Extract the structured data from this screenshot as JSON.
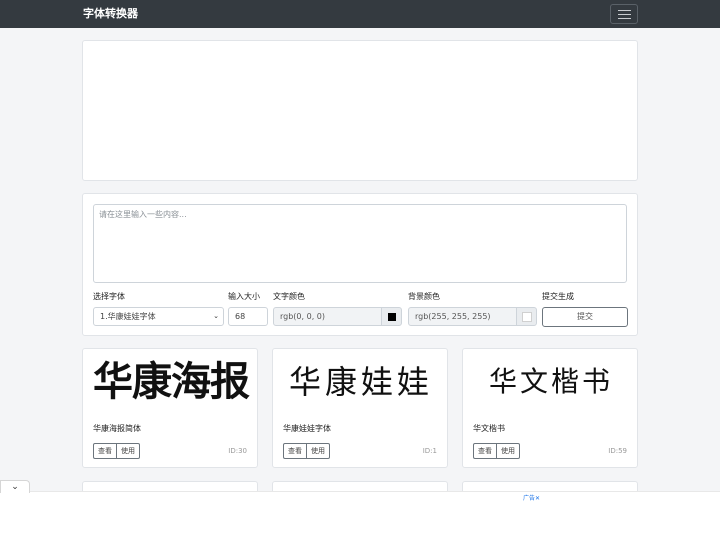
{
  "navbar": {
    "brand": "字体转换器",
    "menu_icon": "hamburger-menu-icon"
  },
  "form": {
    "text_placeholder": "请在这里输入一些内容...",
    "font_label": "选择字体",
    "font_selected": "1.华康娃娃字体",
    "size_label": "输入大小",
    "size_value": "68",
    "text_color_label": "文字颜色",
    "text_color_value": "rgb(0, 0, 0)",
    "text_color_hex": "#000000",
    "bg_color_label": "背景颜色",
    "bg_color_value": "rgb(255, 255, 255)",
    "bg_color_hex": "#ffffff",
    "submit_label": "提交生成",
    "submit_button": "提交"
  },
  "fonts": [
    {
      "sample": "华康海报",
      "name": "华康海报简体",
      "view": "查看",
      "use": "使用",
      "id": "ID:30"
    },
    {
      "sample": "华康娃娃",
      "name": "华康娃娃字体",
      "view": "查看",
      "use": "使用",
      "id": "ID:1"
    },
    {
      "sample": "华文楷书",
      "name": "华文楷书",
      "view": "查看",
      "use": "使用",
      "id": "ID:59"
    }
  ],
  "ad": {
    "label": "广告✕",
    "collapse_icon": "chevron-down-icon",
    "collapse_glyph": "⌄"
  }
}
